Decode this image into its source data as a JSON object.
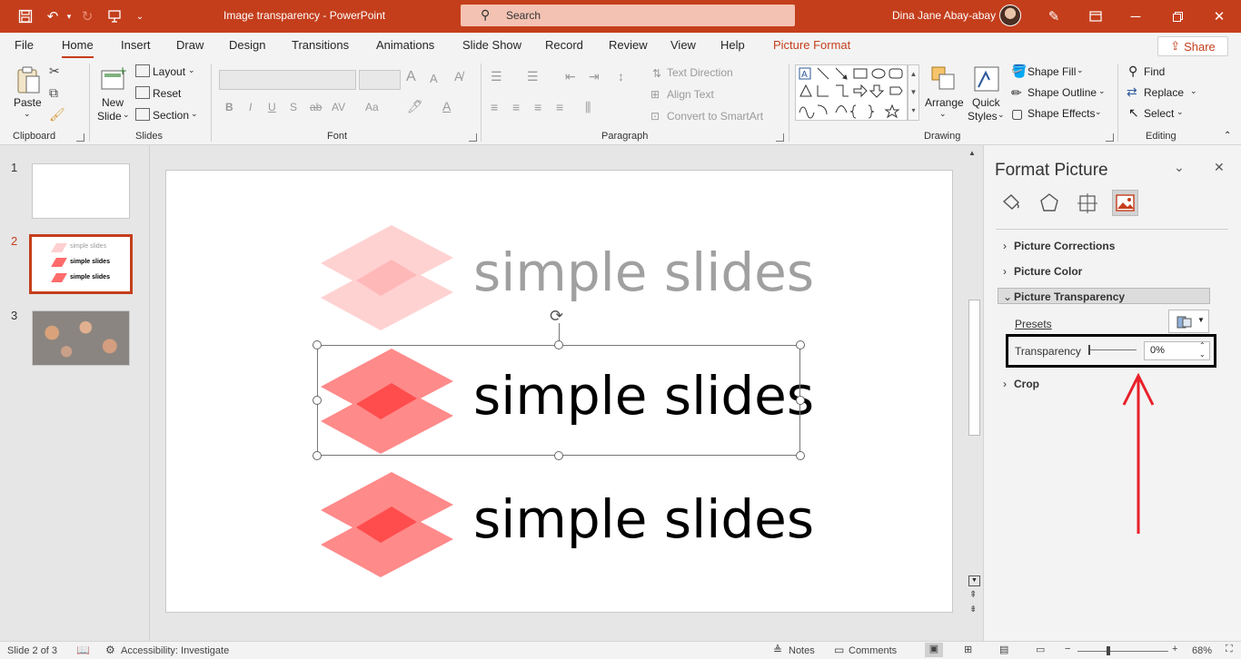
{
  "titlebar": {
    "doc_title": "Image transparency  -  PowerPoint",
    "search_placeholder": "Search",
    "user_name": "Dina Jane Abay-abay"
  },
  "menu": {
    "tabs": [
      "File",
      "Home",
      "Insert",
      "Draw",
      "Design",
      "Transitions",
      "Animations",
      "Slide Show",
      "Record",
      "Review",
      "View",
      "Help",
      "Picture Format"
    ],
    "share_label": "Share"
  },
  "ribbon": {
    "clipboard": {
      "paste": "Paste",
      "group": "Clipboard"
    },
    "slides": {
      "new_slide_1": "New",
      "new_slide_2": "Slide",
      "layout": "Layout",
      "reset": "Reset",
      "section": "Section",
      "group": "Slides"
    },
    "font": {
      "bold": "B",
      "italic": "I",
      "underline": "U",
      "shadow": "S",
      "strike": "ab",
      "spacing": "AV",
      "case": "Aa",
      "color_a": "A",
      "grow": "A",
      "shrink": "A",
      "group": "Font"
    },
    "paragraph": {
      "text_direction": "Text Direction",
      "align_text": "Align Text",
      "convert_smartart": "Convert to SmartArt",
      "group": "Paragraph"
    },
    "drawing": {
      "arrange": "Arrange",
      "quick_styles_1": "Quick",
      "quick_styles_2": "Styles",
      "shape_fill": "Shape Fill",
      "shape_outline": "Shape Outline",
      "shape_effects": "Shape Effects",
      "group": "Drawing"
    },
    "editing": {
      "find": "Find",
      "replace": "Replace",
      "select": "Select",
      "group": "Editing"
    }
  },
  "thumbnails": {
    "numbers": [
      "1",
      "2",
      "3"
    ],
    "slide2_lines": [
      "simple slides",
      "simple slides",
      "simple slides"
    ]
  },
  "slide": {
    "logo_text": "simple slides",
    "accent_color": "#ff5a5a"
  },
  "format_pane": {
    "title": "Format Picture",
    "sections": {
      "corrections": "Picture Corrections",
      "color": "Picture Color",
      "transparency": "Picture Transparency",
      "crop": "Crop"
    },
    "presets_label": "Presets",
    "transparency_label": "Transparency",
    "transparency_value": "0%"
  },
  "statusbar": {
    "slide_info": "Slide 2 of 3",
    "accessibility": "Accessibility: Investigate",
    "notes": "Notes",
    "comments": "Comments",
    "zoom": "68%"
  },
  "colors": {
    "brand": "#c43e1c",
    "annotation": "#e8202a"
  }
}
